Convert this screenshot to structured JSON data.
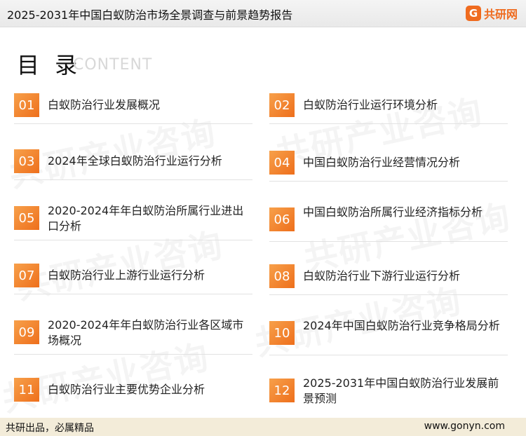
{
  "header": {
    "title": "2025-2031年中国白蚁防治市场全景调查与前景趋势报告",
    "brand_icon": "G",
    "brand_text": "共研网"
  },
  "toc": {
    "title": "目 录",
    "subtitle": "CONTENT"
  },
  "items": [
    {
      "num": "01",
      "label": "白蚁防治行业发展概况"
    },
    {
      "num": "02",
      "label": "白蚁防治行业运行环境分析"
    },
    {
      "num": "03",
      "label": "2024年全球白蚁防治行业运行分析"
    },
    {
      "num": "04",
      "label": "中国白蚁防治行业经营情况分析"
    },
    {
      "num": "05",
      "label": "2020-2024年年白蚁防治所属行业进出口分析"
    },
    {
      "num": "06",
      "label": "中国白蚁防治所属行业经济指标分析"
    },
    {
      "num": "07",
      "label": "白蚁防治行业上游行业运行分析"
    },
    {
      "num": "08",
      "label": "白蚁防治行业下游行业运行分析"
    },
    {
      "num": "09",
      "label": "2020-2024年年白蚁防治行业各区域市场概况"
    },
    {
      "num": "10",
      "label": "2024年中国白蚁防治行业竞争格局分析"
    },
    {
      "num": "11",
      "label": "白蚁防治行业主要优势企业分析"
    },
    {
      "num": "12",
      "label": "2025-2031年中国白蚁防治行业发展前景预测"
    }
  ],
  "footer": {
    "slogan": "共研出品，必属精品",
    "url": "www.gonyn.com"
  },
  "watermark": {
    "text": "共研产业咨询"
  },
  "colors": {
    "accent": "#ee6f1c",
    "footer_bg": "#f3ecd9"
  }
}
